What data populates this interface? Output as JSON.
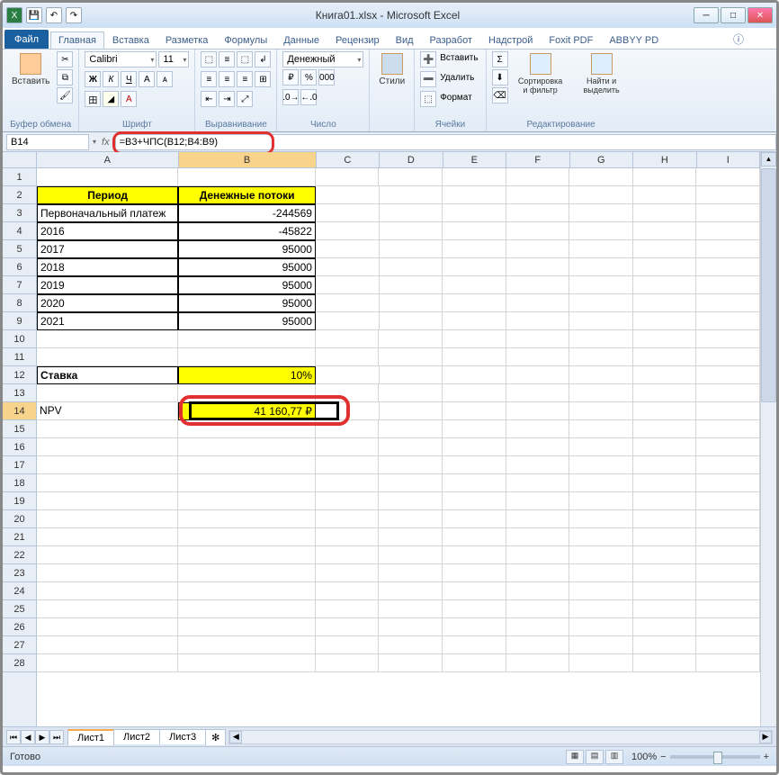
{
  "title": "Книга01.xlsx - Microsoft Excel",
  "qat": {
    "excel_icon": "X",
    "save": "💾",
    "undo": "↶",
    "redo": "↷"
  },
  "tabs": {
    "file": "Файл",
    "items": [
      "Главная",
      "Вставка",
      "Разметка",
      "Формулы",
      "Данные",
      "Рецензир",
      "Вид",
      "Разработ",
      "Надстрой",
      "Foxit PDF",
      "ABBYY PD"
    ],
    "active": 0
  },
  "ribbon": {
    "clipboard": {
      "paste": "Вставить",
      "label": "Буфер обмена"
    },
    "font": {
      "name": "Calibri",
      "size": "11",
      "label": "Шрифт"
    },
    "align": {
      "label": "Выравнивание"
    },
    "number": {
      "format": "Денежный",
      "label": "Число"
    },
    "styles": {
      "btn": "Стили"
    },
    "cells": {
      "insert": "Вставить",
      "delete": "Удалить",
      "format": "Формат",
      "label": "Ячейки"
    },
    "editing": {
      "sort": "Сортировка и фильтр",
      "find": "Найти и выделить",
      "label": "Редактирование"
    }
  },
  "namebox": "B14",
  "formula": "=B3+ЧПС(B12;B4:B9)",
  "cols": [
    "A",
    "B",
    "C",
    "D",
    "E",
    "F",
    "G",
    "H",
    "I"
  ],
  "rows": [
    "1",
    "2",
    "3",
    "4",
    "5",
    "6",
    "7",
    "8",
    "9",
    "10",
    "11",
    "12",
    "13",
    "14",
    "15",
    "16",
    "17",
    "18",
    "19",
    "20",
    "21",
    "22",
    "23",
    "24",
    "25",
    "26",
    "27",
    "28"
  ],
  "data": {
    "h1": "Период",
    "h2": "Денежные потоки",
    "r3a": "Первоначальный платеж",
    "r3b": "-244569",
    "r4a": "2016",
    "r4b": "-45822",
    "r5a": "2017",
    "r5b": "95000",
    "r6a": "2018",
    "r6b": "95000",
    "r7a": "2019",
    "r7b": "95000",
    "r8a": "2020",
    "r8b": "95000",
    "r9a": "2021",
    "r9b": "95000",
    "r12a": "Ставка",
    "r12b": "10%",
    "r14a": "NPV",
    "r14b": "41 160,77 ₽"
  },
  "sheets": [
    "Лист1",
    "Лист2",
    "Лист3"
  ],
  "status": "Готово",
  "zoom": "100%"
}
